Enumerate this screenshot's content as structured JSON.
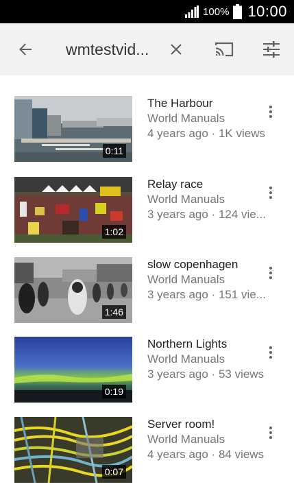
{
  "status_bar": {
    "battery_percent": "100%",
    "time": "10:00",
    "icons": [
      "signal-icon",
      "battery-icon"
    ]
  },
  "app_bar": {
    "search_query": "wmtestvid...",
    "icons": [
      "back-arrow-icon",
      "close-icon",
      "cast-icon",
      "filter-icon"
    ]
  },
  "results": [
    {
      "title": "The Harbour",
      "channel": "World Manuals",
      "stats": "4 years ago · 1K views",
      "duration": "0:11"
    },
    {
      "title": "Relay race",
      "channel": "World Manuals",
      "stats": "3 years ago · 124 vie...",
      "duration": "1:02"
    },
    {
      "title": "slow copenhagen",
      "channel": "World Manuals",
      "stats": "3 years ago · 151 vie...",
      "duration": "1:46"
    },
    {
      "title": "Northern Lights",
      "channel": "World Manuals",
      "stats": "3 years ago · 53 views",
      "duration": "0:19"
    },
    {
      "title": "Server room!",
      "channel": "World Manuals",
      "stats": "4 years ago · 84 views",
      "duration": "0:07"
    }
  ],
  "colors": {
    "status_bar_bg": "#000000",
    "app_bar_bg": "#f2f2f2",
    "icon_color": "#616161",
    "title_color": "#212121",
    "secondary_text": "#777777"
  }
}
